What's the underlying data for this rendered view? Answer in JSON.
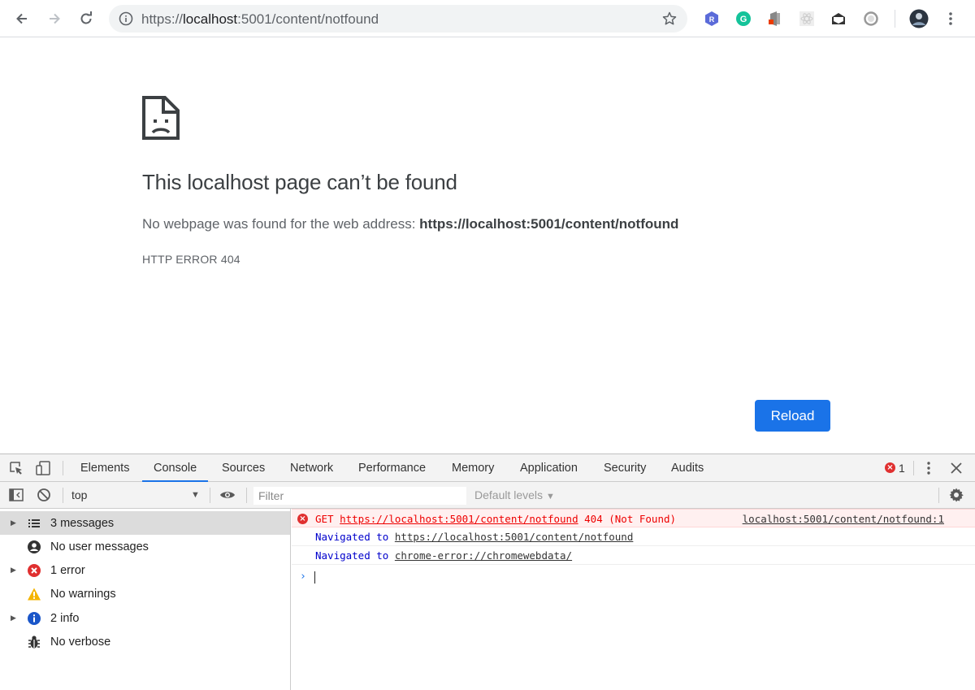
{
  "browser": {
    "url_prefix": "https://",
    "url_host": "localhost",
    "url_rest": ":5001/content/notfound",
    "extensions": [
      "R",
      "G"
    ]
  },
  "page": {
    "title": "This localhost page can’t be found",
    "message_prefix": "No webpage was found for the web address:",
    "message_address": "https://localhost:5001/content/notfound",
    "error_code": "HTTP ERROR 404",
    "reload_label": "Reload"
  },
  "devtools": {
    "tabs": [
      "Elements",
      "Console",
      "Sources",
      "Network",
      "Performance",
      "Memory",
      "Application",
      "Security",
      "Audits"
    ],
    "active_tab": "Console",
    "error_count": "1",
    "context": "top",
    "filter_placeholder": "Filter",
    "levels_label": "Default levels",
    "sidebar": [
      {
        "label": "3 messages",
        "icon": "list-icon",
        "expandable": true
      },
      {
        "label": "No user messages",
        "icon": "user-icon",
        "expandable": false
      },
      {
        "label": "1 error",
        "icon": "error-icon",
        "expandable": true
      },
      {
        "label": "No warnings",
        "icon": "warning-icon",
        "expandable": false
      },
      {
        "label": "2 info",
        "icon": "info-icon",
        "expandable": true
      },
      {
        "label": "No verbose",
        "icon": "bug-icon",
        "expandable": false
      }
    ],
    "console": {
      "error": {
        "method": "GET",
        "url": "https://localhost:5001/content/notfound",
        "status": "404 (Not Found)",
        "source": "localhost:5001/content/notfound:1"
      },
      "nav1": {
        "prefix": "Navigated to",
        "url": "https://localhost:5001/content/notfound"
      },
      "nav2": {
        "prefix": "Navigated to",
        "url": "chrome-error://chromewebdata/"
      },
      "prompt": "›"
    }
  },
  "colors": {
    "accent": "#1a73e8",
    "error": "#e03030",
    "warning": "#f4b400",
    "info": "#1a56c9"
  }
}
